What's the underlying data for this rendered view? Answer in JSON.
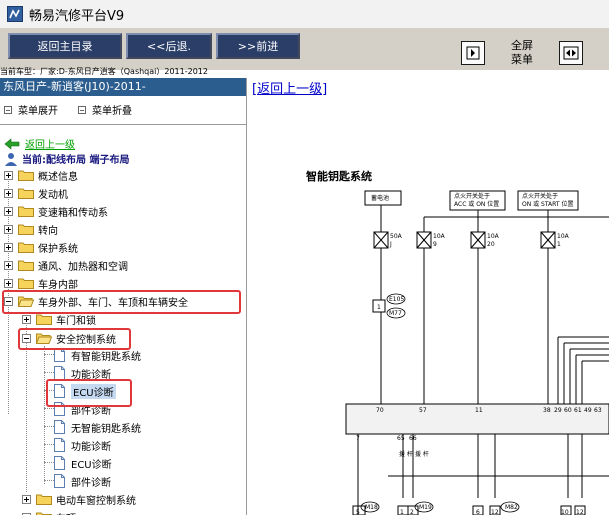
{
  "window": {
    "title": "畅易汽修平台V9",
    "icon": "app-icon"
  },
  "toolbar": {
    "back_main": "返回主目录",
    "back_step": "<<后退.",
    "forward": ">>前进",
    "fullscreen_label": "全屏",
    "menu_label": "菜单"
  },
  "info_line": "当前车型：厂家:D-东风日产逍客（Qashqai）2011-2012",
  "left": {
    "model": "东风日产-新逍客(J10)-2011-",
    "expand_menu": "菜单展开",
    "collapse_menu": "菜单折叠",
    "back_link": "返回上一级",
    "current": "当前:配线布局 端子布局",
    "tree": [
      {
        "label": "概述信息"
      },
      {
        "label": "发动机"
      },
      {
        "label": "变速箱和传动系"
      },
      {
        "label": "转向"
      },
      {
        "label": "保护系统"
      },
      {
        "label": "通风、加热器和空调"
      },
      {
        "label": "车身内部"
      },
      {
        "label": "车身外部、车门、车顶和车辆安全"
      },
      {
        "label": "车门和锁"
      },
      {
        "label": "安全控制系统"
      },
      {
        "label": "有智能钥匙系统"
      },
      {
        "label": "功能诊断"
      },
      {
        "label": "ECU诊断"
      },
      {
        "label": "部件诊断"
      },
      {
        "label": "无智能钥匙系统"
      },
      {
        "label": "功能诊断"
      },
      {
        "label": "ECU诊断"
      },
      {
        "label": "部件诊断"
      },
      {
        "label": "电动车窗控制系统"
      },
      {
        "label": "车顶"
      }
    ]
  },
  "right": {
    "return_link": "[返回上一级]",
    "diagram": {
      "title": "智能钥匙系统",
      "box_battery": "蓄电池",
      "box_acc_1": "点火开关处于",
      "box_acc_2": "ACC 或 ON 位置",
      "box_start_1": "点火开关处于",
      "box_start_2": "ON 或 START 位置",
      "fuse_1_a": "50A",
      "fuse_1_b": "J",
      "fuse_2_a": "10A",
      "fuse_2_b": "9",
      "fuse_3_a": "10A",
      "fuse_3_b": "20",
      "fuse_4_a": "10A",
      "fuse_4_b": "1",
      "pin_top": "1",
      "conn_e105": "E105",
      "conn_m77": "M77",
      "pin_70": "70",
      "pin_57": "57",
      "pin_11": "11",
      "pin_38": "38",
      "pin_29": "29",
      "pin_60": "60",
      "pin_61": "61",
      "pin_49": "49",
      "pin_6x": "63",
      "pin_7": "7",
      "pin_65": "65",
      "pin_66": "66",
      "label_wire_a": "援\n杆",
      "label_wire_b": "援\n杆",
      "conn_m18": "M18",
      "conn_m19": "M19",
      "conn_m82": "M82",
      "bottom_pin_5": "5",
      "bottom_pin_1": "1",
      "bottom_pin_2": "2",
      "bottom_pin_6": "6",
      "bottom_pin_12": "12",
      "bottom_pin_10": "10",
      "bottom_pin_11": "12"
    }
  }
}
